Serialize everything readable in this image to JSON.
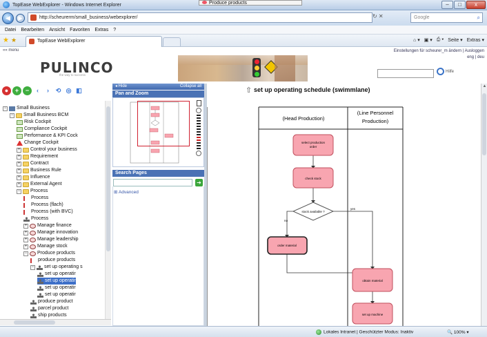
{
  "window": {
    "title": "TopEase WebExplorer - Windows Internet Explorer",
    "buttons": [
      "–",
      "□",
      "x"
    ]
  },
  "floating_tip": {
    "label": "Produce products"
  },
  "address": {
    "url": "http://scheurerm/small_business/webexplorer/",
    "search_placeholder": "Google",
    "back": "◀",
    "forward": "▶",
    "refresh_stop": "↻  ✕"
  },
  "menubar": [
    "Datei",
    "Bearbeiten",
    "Ansicht",
    "Favoriten",
    "Extras",
    "?"
  ],
  "tab": {
    "label": "TopEase WebExplorer"
  },
  "command_bar": [
    "⌂ ▾",
    "▣ ▾",
    "⎙ ▾",
    "Seite ▾",
    "Extras ▾"
  ],
  "app_header": {
    "menu_link": "«« menu",
    "logo": "PULINCO",
    "tagline": "the way to success",
    "user_line": "Einstellungen für scheurer_m ändern | Ausloggen",
    "lang_line": "eng | deu",
    "help": "Hilfe"
  },
  "left_toolbar": [
    "●",
    "+",
    "−",
    "‹",
    "›",
    "⟲",
    "◎",
    "◧"
  ],
  "tree": {
    "nodes": [
      {
        "label": "Small Business",
        "indent": 0,
        "icon": "db-icon",
        "expander": "−"
      },
      {
        "label": "Small Business BCM",
        "indent": 1,
        "icon": "folder-icon",
        "expander": "−"
      },
      {
        "label": "Risk Cockpit",
        "indent": 2,
        "icon": "document-icon",
        "expander": ""
      },
      {
        "label": "Compliance Cockpit",
        "indent": 2,
        "icon": "cockpit-icon",
        "expander": ""
      },
      {
        "label": "Performance & KPI Cock",
        "indent": 2,
        "icon": "cockpit-icon",
        "expander": ""
      },
      {
        "label": "Change Cockpit",
        "indent": 2,
        "icon": "warning-icon",
        "expander": ""
      },
      {
        "label": "Control your business",
        "indent": 2,
        "icon": "folder-icon",
        "expander": "+"
      },
      {
        "label": "Requirement",
        "indent": 2,
        "icon": "folder-icon",
        "expander": "+"
      },
      {
        "label": "Contract",
        "indent": 2,
        "icon": "folder-icon",
        "expander": "+"
      },
      {
        "label": "Business Rule",
        "indent": 2,
        "icon": "folder-icon",
        "expander": "+"
      },
      {
        "label": "Influence",
        "indent": 2,
        "icon": "folder-icon",
        "expander": "+"
      },
      {
        "label": "External Agent",
        "indent": 2,
        "icon": "folder-icon",
        "expander": "+"
      },
      {
        "label": "Process",
        "indent": 2,
        "icon": "folder-icon",
        "expander": "−"
      },
      {
        "label": "Process",
        "indent": 3,
        "icon": "process-doc-icon",
        "expander": ""
      },
      {
        "label": "Process (flach)",
        "indent": 3,
        "icon": "process-doc-icon",
        "expander": ""
      },
      {
        "label": "Process (with BVC)",
        "indent": 3,
        "icon": "process-doc-icon",
        "expander": ""
      },
      {
        "label": "Process",
        "indent": 3,
        "icon": "person-icon",
        "expander": ""
      },
      {
        "label": "Manage finance",
        "indent": 3,
        "icon": "process-icon",
        "expander": "+"
      },
      {
        "label": "Manage innovation",
        "indent": 3,
        "icon": "process-icon",
        "expander": "+"
      },
      {
        "label": "Manage leadership",
        "indent": 3,
        "icon": "process-icon",
        "expander": "+"
      },
      {
        "label": "Manage stock",
        "indent": 3,
        "icon": "process-icon",
        "expander": "+"
      },
      {
        "label": "Produce products",
        "indent": 3,
        "icon": "process-icon",
        "expander": "−"
      },
      {
        "label": "produce products",
        "indent": 4,
        "icon": "process-doc-icon",
        "expander": ""
      },
      {
        "label": "set up operating s",
        "indent": 4,
        "icon": "swimlane-icon",
        "expander": "−"
      },
      {
        "label": "set up operatir",
        "indent": 5,
        "icon": "person-icon",
        "expander": ""
      },
      {
        "label": "set up operatir",
        "indent": 5,
        "icon": "person-icon",
        "expander": "",
        "selected": true
      },
      {
        "label": "set up operatir",
        "indent": 5,
        "icon": "person-icon",
        "expander": ""
      },
      {
        "label": "set up operatir",
        "indent": 5,
        "icon": "person-icon",
        "expander": ""
      },
      {
        "label": "produce product",
        "indent": 4,
        "icon": "swimlane-icon",
        "expander": ""
      },
      {
        "label": "parcel product",
        "indent": 4,
        "icon": "swimlane-icon",
        "expander": ""
      },
      {
        "label": "ship products",
        "indent": 4,
        "icon": "swimlane-icon",
        "expander": ""
      }
    ]
  },
  "middle": {
    "hide": "◂ Hide",
    "collapse_all": "Collapse all",
    "pan_zoom": "Pan and Zoom",
    "search_pages": "Search Pages",
    "advanced": "Advanced",
    "go": "➔"
  },
  "diagram": {
    "title": "set up operating schedule (swimmlane)",
    "lane_headers": [
      "(Head Production)",
      "(Line Personnel Production)"
    ],
    "shapes": {
      "select_order": "select production order",
      "check_stock": "check stock",
      "decision": "stock available ?",
      "order_material": "order material",
      "obtain_material": "obtain material",
      "setup_machine": "set up machine"
    },
    "edge_labels": {
      "no": "no",
      "yes": "yes"
    }
  },
  "status": {
    "zone": "Lokales Intranet | Geschützter Modus: Inaktiv",
    "zoom": "100%"
  },
  "colors": {
    "shape_fill": "#f8a5b0",
    "shape_stroke": "#c0505e",
    "selected_tree": "#3d6fc8",
    "viewport": "#d0202f"
  }
}
